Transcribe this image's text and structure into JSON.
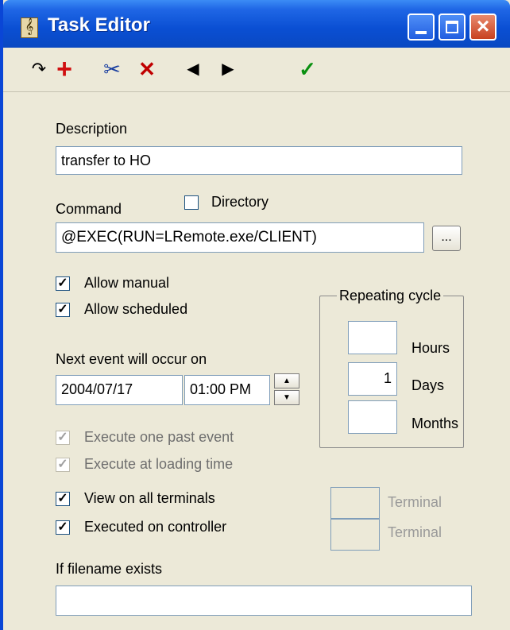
{
  "window": {
    "title": "Task Editor"
  },
  "toolbar": {
    "redo_icon": "↷",
    "add_icon": "+",
    "cut_icon": "✂",
    "delete_icon": "✕",
    "prev_icon": "◀",
    "next_icon": "▶",
    "ok_icon": "✓",
    "colors": {
      "add": "#d01010",
      "delete": "#c00000",
      "ok": "#0a9010"
    }
  },
  "form": {
    "description_label": "Description",
    "description_value": "transfer to HO",
    "command_label": "Command",
    "directory_label": "Directory",
    "directory_checked": "",
    "command_value": "@EXEC(RUN=LRemote.exe/CLIENT)",
    "browse_label": "...",
    "allow_manual_label": "Allow manual",
    "allow_manual_check": "✓",
    "allow_scheduled_label": "Allow scheduled",
    "allow_scheduled_check": "✓",
    "next_event_label": "Next event will occur on",
    "date_value": "2004/07/17",
    "time_value": "01:00 PM",
    "spin_up": "▲",
    "spin_down": "▼",
    "repeating": {
      "title": "Repeating cycle",
      "hours_label": "Hours",
      "hours_value": "",
      "days_label": "Days",
      "days_value": "1",
      "months_label": "Months",
      "months_value": ""
    },
    "execute_past_label": "Execute one past event",
    "execute_past_check": "✓",
    "execute_loading_label": "Execute at loading time",
    "execute_loading_check": "✓",
    "view_all_label": "View on all terminals",
    "view_all_check": "✓",
    "terminal1_label": "Terminal",
    "terminal1_value": "",
    "executed_controller_label": "Executed on controller",
    "executed_controller_check": "✓",
    "terminal2_label": "Terminal",
    "terminal2_value": "",
    "filename_label": "If filename exists",
    "filename_value": ""
  }
}
